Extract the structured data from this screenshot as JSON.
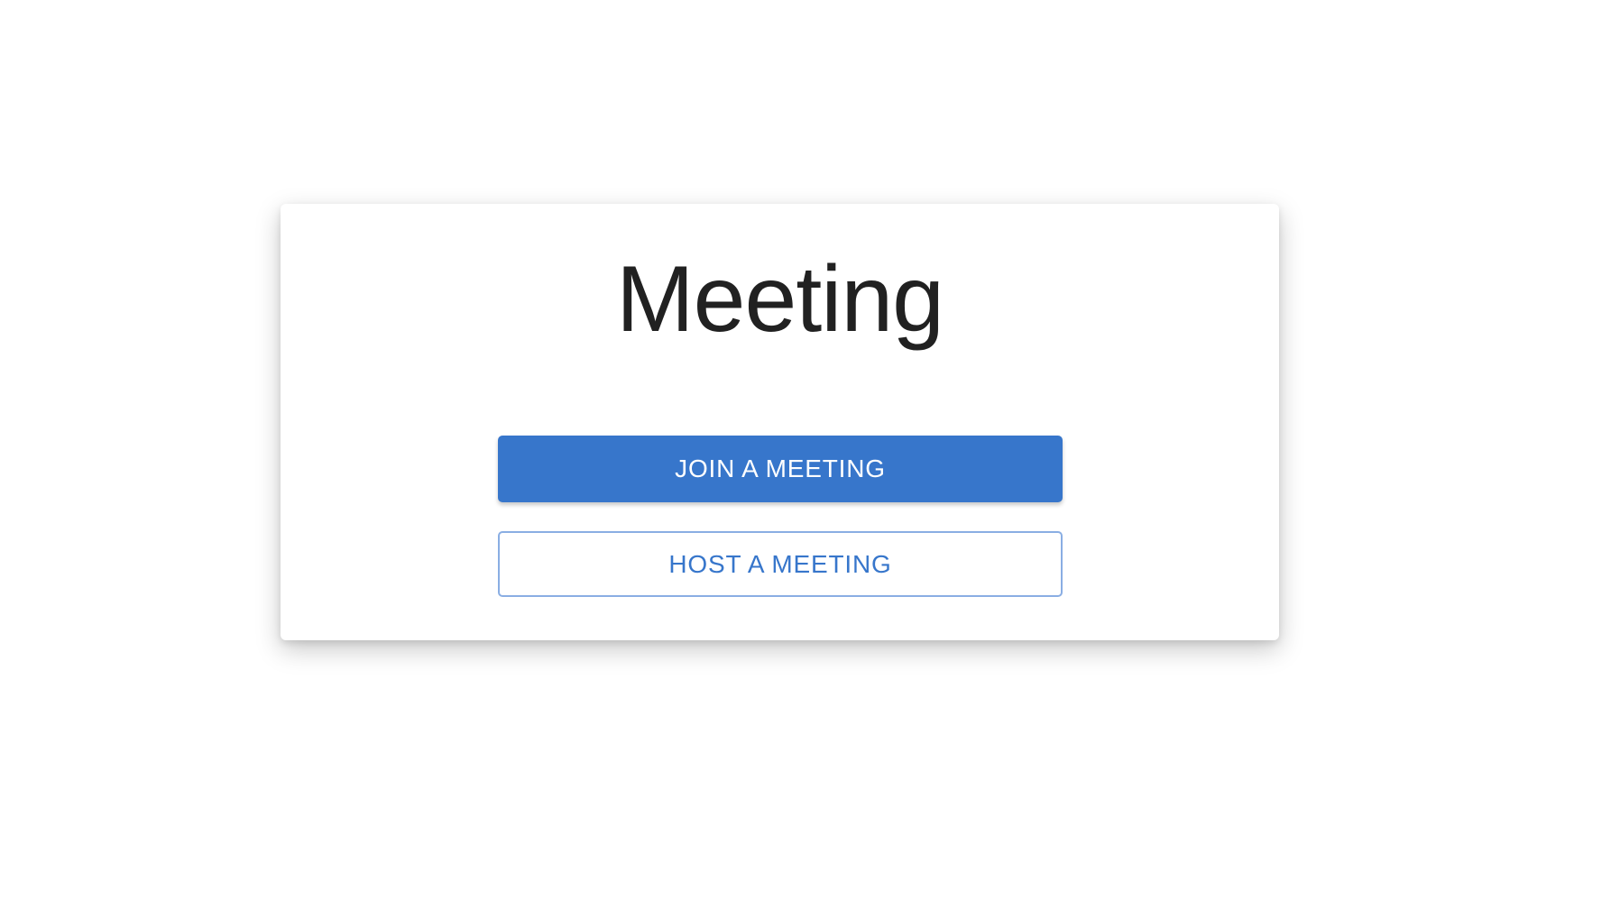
{
  "card": {
    "title": "Meeting"
  },
  "actions": {
    "join_label": "JOIN A MEETING",
    "host_label": "HOST A MEETING"
  },
  "colors": {
    "accent": "#3776cb",
    "outline_border": "#8aaee3",
    "title_text": "#212121",
    "background": "#ffffff"
  }
}
